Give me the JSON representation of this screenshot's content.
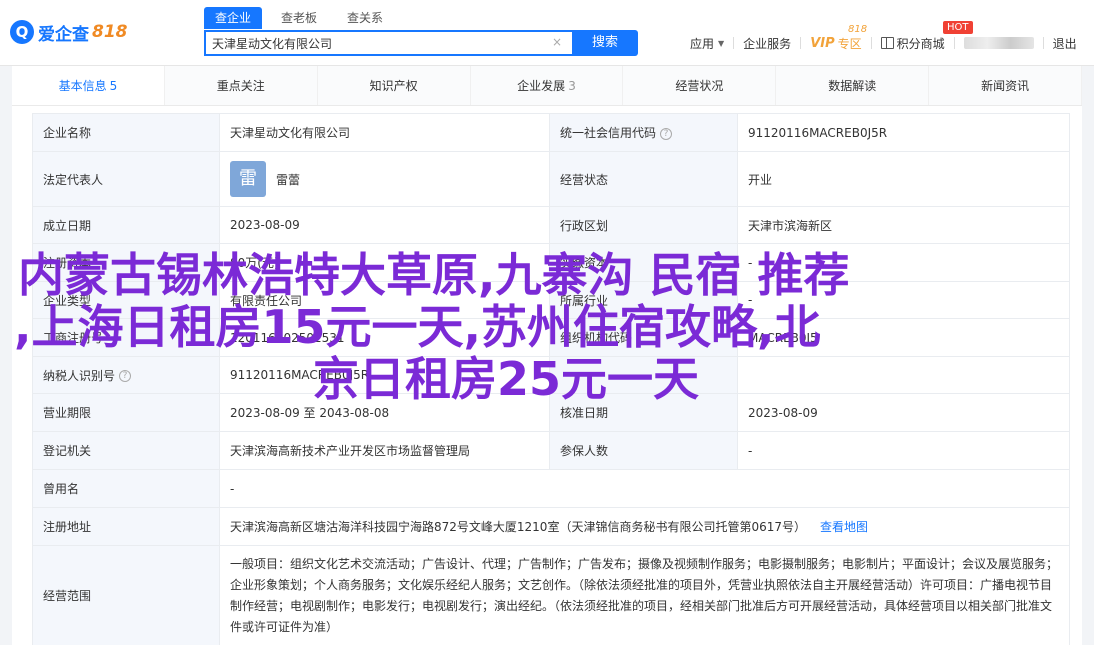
{
  "header": {
    "logo_mark": "Q",
    "logo_text": "爱企查",
    "logo_badge": "818",
    "search_tabs": [
      "查企业",
      "查老板",
      "查关系"
    ],
    "search_value": "天津星动文化有限公司",
    "search_button": "搜索",
    "nav": {
      "app": "应用",
      "service": "企业服务",
      "vip": "VIP",
      "vip_sub": "专区",
      "vip_badge": "818",
      "points": "积分商城",
      "hot": "HOT",
      "logout": "退出"
    }
  },
  "tabs": [
    {
      "label": "基本信息",
      "count": "5"
    },
    {
      "label": "重点关注",
      "count": ""
    },
    {
      "label": "知识产权",
      "count": ""
    },
    {
      "label": "企业发展",
      "count": "3"
    },
    {
      "label": "经营状况",
      "count": ""
    },
    {
      "label": "数据解读",
      "count": ""
    },
    {
      "label": "新闻资讯",
      "count": ""
    }
  ],
  "info": {
    "company_name_label": "企业名称",
    "company_name": "天津星动文化有限公司",
    "credit_code_label": "统一社会信用代码",
    "credit_code": "91120116MACREB0J5R",
    "legal_rep_label": "法定代表人",
    "legal_rep_avatar": "雷",
    "legal_rep": "雷蕾",
    "status_label": "经营状态",
    "status": "开业",
    "founded_label": "成立日期",
    "founded": "2023-08-09",
    "region_label": "行政区划",
    "region": "天津市滨海新区",
    "capital_label": "注册资本",
    "capital": "80万(元)",
    "paid_label": "实缴资本",
    "paid": "-",
    "type_label": "企业类型",
    "type": "有限责任公司",
    "industry_label": "所属行业",
    "industry": "-",
    "reg_no_label": "工商注册号",
    "reg_no": "120116002502531",
    "org_code_label": "组织机构代码",
    "org_code": "MACREB0J5",
    "taxpayer_label": "纳税人识别号",
    "taxpayer": "91120116MACREB0J5R",
    "term_label": "营业期限",
    "term": "2023-08-09 至 2043-08-08",
    "approve_label": "核准日期",
    "approve": "2023-08-09",
    "authority_label": "登记机关",
    "authority": "天津滨海高新技术产业开发区市场监督管理局",
    "insured_label": "参保人数",
    "insured": "-",
    "former_label": "曾用名",
    "former": "-",
    "address_label": "注册地址",
    "address": "天津滨海高新区塘沽海洋科技园宁海路872号文峰大厦1210室（天津锦信商务秘书有限公司托管第0617号）",
    "map_link": "查看地图",
    "scope_label": "经营范围",
    "scope": "一般项目：组织文化艺术交流活动；广告设计、代理；广告制作；广告发布；摄像及视频制作服务；电影摄制服务；电影制片；平面设计；会议及展览服务；企业形象策划；个人商务服务；文化娱乐经纪人服务；文艺创作。（除依法须经批准的项目外，凭营业执照依法自主开展经营活动）许可项目：广播电视节目制作经营；电视剧制作；电影发行；电视剧发行；演出经纪。（依法须经批准的项目，经相关部门批准后方可开展经营活动，具体经营项目以相关部门批准文件或许可证件为准）"
  },
  "overlay": {
    "line1": "内蒙古锡林浩特大草原,九寨沟 民宿 推荐",
    "line2": ",上海日租房15元一天,苏州住宿攻略,北",
    "line3": "京日租房25元一天"
  }
}
